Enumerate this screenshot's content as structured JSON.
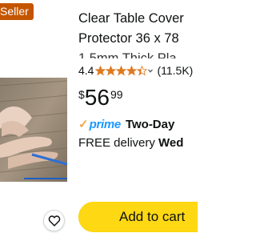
{
  "product": {
    "badge": "Seller",
    "title_lines": [
      "Clear Table Cover",
      "Protector 36 x 78",
      "1.5mm Thick Pla"
    ],
    "rating": {
      "value": "4.4",
      "stars": 4.4,
      "count": "(11.5K)"
    },
    "price": {
      "symbol": "$",
      "whole": "56",
      "fraction": "99"
    },
    "shipping": {
      "check": "✓",
      "prime_label": "prime",
      "speed": "Two-Day"
    },
    "delivery": {
      "prefix": "FREE delivery",
      "day": "Wed"
    },
    "add_to_cart_label": "Add to cart",
    "icons": {
      "wishlist": "heart-icon",
      "star": "star-icon"
    }
  },
  "colors": {
    "badge_bg": "#c45500",
    "star": "#de7921",
    "prime_blue": "#1a98ff",
    "prime_check": "#f3a847",
    "cart_button": "#ffd814"
  }
}
